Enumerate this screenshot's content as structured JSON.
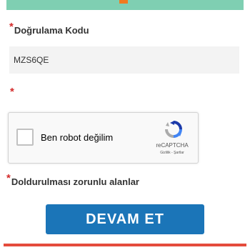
{
  "form": {
    "required_marker": "*",
    "verification_label": "Doğrulama Kodu",
    "verification_value": "MZS6QE"
  },
  "recaptcha": {
    "checkbox_label": "Ben robot değilim",
    "brand": "reCAPTCHA",
    "links": "Gizlilik - Şartlar"
  },
  "footer": {
    "required_note": "Doldurulması zorunlu alanlar",
    "continue_label": "DEVAM ET"
  },
  "colors": {
    "top_bar": "#7fcfb2",
    "accent_orange": "#f07a1f",
    "button": "#1b75b8",
    "required": "#d42b2b",
    "bottom_bar": "#e44b3c"
  }
}
